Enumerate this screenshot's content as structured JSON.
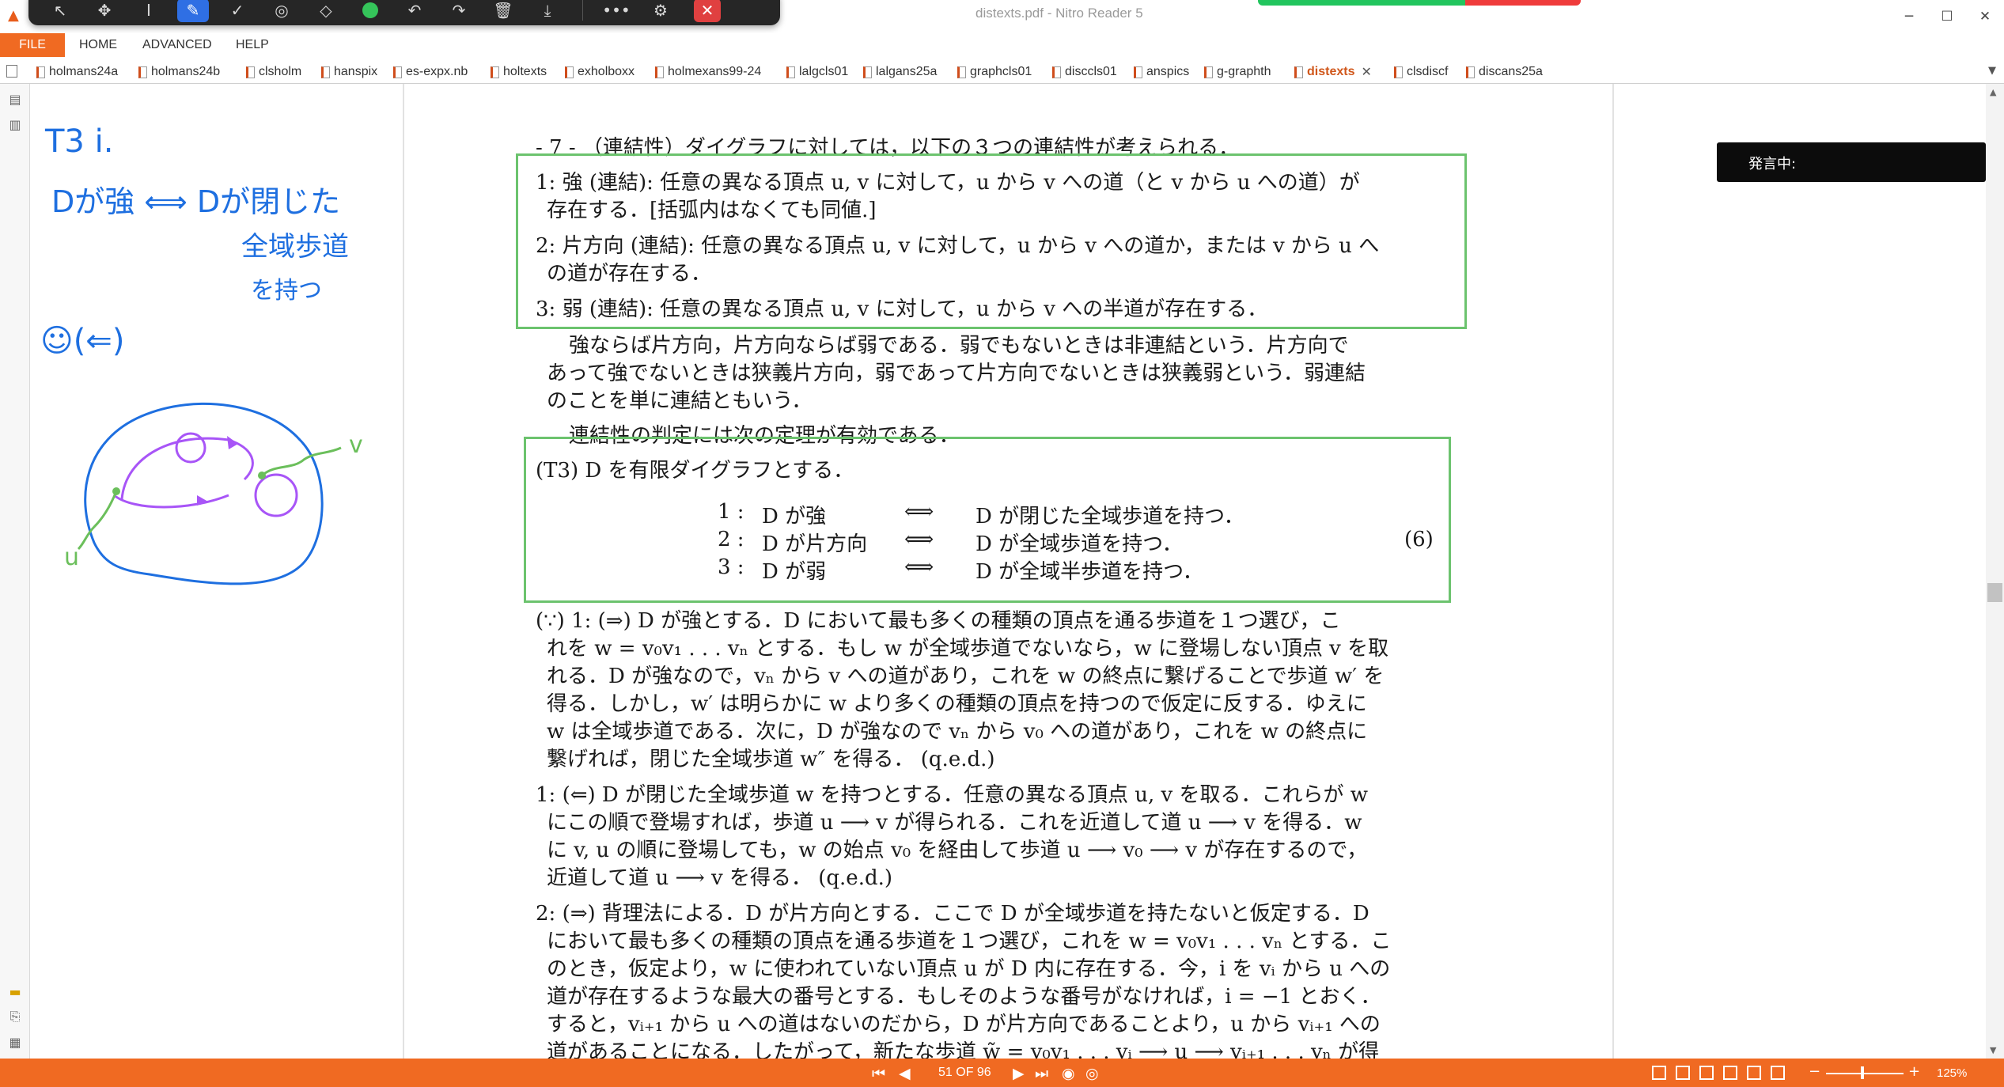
{
  "app": {
    "window_title": "distexts.pdf - Nitro Reader 5",
    "window_controls": {
      "minimize": "─",
      "maximize": "☐",
      "close": "✕"
    }
  },
  "ribbon": {
    "file": "FILE",
    "home": "HOME",
    "advanced": "ADVANCED",
    "help": "HELP"
  },
  "tabs": [
    {
      "label": "holmans24a"
    },
    {
      "label": "holmans24b"
    },
    {
      "label": "clsholm"
    },
    {
      "label": "hanspix"
    },
    {
      "label": "es-expx.nb"
    },
    {
      "label": "holtexts"
    },
    {
      "label": "exholboxx"
    },
    {
      "label": "holmexans99-24"
    },
    {
      "label": "lalgcls01"
    },
    {
      "label": "lalgans25a"
    },
    {
      "label": "graphcls01"
    },
    {
      "label": "disccls01"
    },
    {
      "label": "anspics"
    },
    {
      "label": "g-graphth"
    },
    {
      "label": "distexts",
      "active": true
    },
    {
      "label": "clsdiscf"
    },
    {
      "label": "discans25a"
    }
  ],
  "tab_close_glyph": "✕",
  "speaking_indicator": "発言中:",
  "notes": {
    "line1": "T3 i.",
    "line2": "Dが強 ⟺ Dが閉じた",
    "line3": "全域歩道",
    "line4": "を持つ",
    "line5": "☺(⇐)",
    "label_u": "u",
    "label_v": "v"
  },
  "document": {
    "header": "- 7 - （連結性）ダイグラフに対しては，以下の３つの連結性が考えられる．",
    "defs": [
      "1: 強 (連結): 任意の異なる頂点 u, v に対して，u から v への道（と v から u への道）が",
      "存在する．[括弧内はなくても同値.]",
      "2: 片方向 (連結): 任意の異なる頂点 u, v に対して，u から v への道か，または v から u へ",
      "の道が存在する．",
      "3: 弱 (連結): 任意の異なる頂点 u, v に対して，u から v への半道が存在する．"
    ],
    "para1": [
      "強ならば片方向，片方向ならば弱である．弱でもないときは非連結という．片方向で",
      "あって強でないときは狭義片方向，弱であって片方向でないときは狭義弱という．弱連結",
      "のことを単に連結ともいう．"
    ],
    "para2": "連結性の判定には次の定理が有効である．",
    "theorem_title": "(T3)  D を有限ダイグラフとする．",
    "theorem_rows": [
      {
        "num": "1 :",
        "lhs": "D が強",
        "iff": "⟺",
        "rhs": "D が閉じた全域歩道を持つ．"
      },
      {
        "num": "2 :",
        "lhs": "D が片方向",
        "iff": "⟺",
        "rhs": "D が全域歩道を持つ．"
      },
      {
        "num": "3 :",
        "lhs": "D が弱",
        "iff": "⟺",
        "rhs": "D が全域半歩道を持つ．"
      }
    ],
    "equation_number": "(6)",
    "proof1": [
      "(∵) 1: (⇒) D が強とする．D において最も多くの種類の頂点を通る歩道を１つ選び，こ",
      "れを w = v₀v₁ . . . vₙ とする．もし w が全域歩道でないなら，w に登場しない頂点 v を取",
      "れる．D が強なので，vₙ から v への道があり，これを w の終点に繋げることで歩道 w′ を",
      "得る．しかし，w′ は明らかに w より多くの種類の頂点を持つので仮定に反する．ゆえに",
      "w は全域歩道である．次に，D が強なので vₙ から v₀ への道があり，これを w の終点に",
      "繋げれば，閉じた全域歩道 w″ を得る．  (q.e.d.)"
    ],
    "proof2": [
      "1: (⇐) D が閉じた全域歩道 w を持つとする．任意の異なる頂点 u, v を取る．これらが w",
      "にこの順で登場すれば，歩道 u ⟶ v が得られる．これを近道して道 u ⟶ v を得る．w",
      "に v, u の順に登場しても，w の始点 v₀ を経由して歩道 u ⟶ v₀ ⟶ v が存在するので，",
      "近道して道 u ⟶ v を得る．  (q.e.d.)"
    ],
    "proof3": [
      "2: (⇒) 背理法による．D が片方向とする．ここで D が全域歩道を持たないと仮定する．D",
      "において最も多くの種類の頂点を通る歩道を１つ選び，これを w = v₀v₁ . . . vₙ とする．こ",
      "のとき，仮定より，w に使われていない頂点 u が D 内に存在する．今，i を vᵢ から u への",
      "道が存在するような最大の番号とする．もしそのような番号がなければ，i = −1 とおく．",
      "すると，vᵢ₊₁ から u への道はないのだから，D が片方向であることより，u から vᵢ₊₁ への",
      "道があることになる．したがって，新たな歩道 w̃ = v₀v₁ . . . vᵢ ⟶ u ⟶ vᵢ₊₁ . . . vₙ が得"
    ]
  },
  "status": {
    "page_indicator": "51 OF 96",
    "zoom": "125%",
    "zoom_minus": "−",
    "zoom_plus": "+"
  },
  "colors": {
    "accent_orange": "#f06a22",
    "box_green": "#6cc36e",
    "ink_blue": "#1e6fe0",
    "ink_purple": "#a855f7",
    "ink_green": "#6bbf5b"
  }
}
